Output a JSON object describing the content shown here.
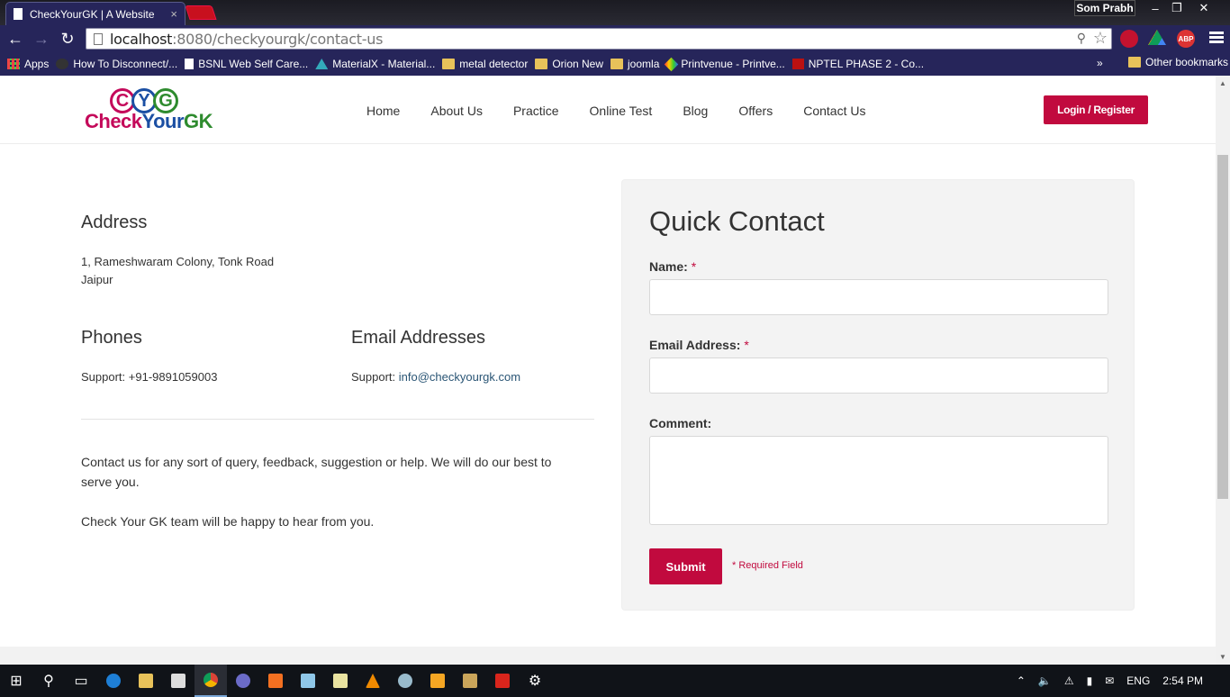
{
  "browser": {
    "tab_title": "CheckYourGK | A Website",
    "tab_close": "×",
    "user": "Som Prabh",
    "window_controls": [
      "–",
      "❐",
      "✕"
    ],
    "url_host": "localhost",
    "url_rest": ":8080/checkyourgk/contact-us",
    "extensions": [
      "ABP"
    ],
    "bookmarks": [
      {
        "label": "Apps",
        "icon": "apps-icon"
      },
      {
        "label": "How To Disconnect/...",
        "icon": "site-icon"
      },
      {
        "label": "BSNL Web Self Care...",
        "icon": "page-icon"
      },
      {
        "label": "MaterialX - Material...",
        "icon": "materialx-icon"
      },
      {
        "label": "metal detector",
        "icon": "folder-icon"
      },
      {
        "label": "Orion New",
        "icon": "folder-icon"
      },
      {
        "label": "joomla",
        "icon": "folder-icon"
      },
      {
        "label": "Printvenue - Printve...",
        "icon": "printvenue-icon"
      },
      {
        "label": "NPTEL PHASE 2 - Co...",
        "icon": "nptel-icon"
      }
    ],
    "bookmarks_more": "»",
    "other_bookmarks": "Other bookmarks"
  },
  "site": {
    "logo_letters": [
      "C",
      "Y",
      "G"
    ],
    "logo_word_1": "Check",
    "logo_word_2": "Your",
    "logo_word_3": "GK",
    "nav": [
      "Home",
      "About Us",
      "Practice",
      "Online Test",
      "Blog",
      "Offers",
      "Contact Us"
    ],
    "login_label": "Login / Register",
    "colors": {
      "accent": "#c10a3e",
      "logo_magenta": "#c4095a",
      "logo_blue": "#1b4fa3",
      "logo_green": "#2e8b2e"
    }
  },
  "contact_info": {
    "address_title": "Address",
    "address_line1": "1, Rameshwaram Colony, Tonk Road",
    "address_line2": "Jaipur",
    "phones_title": "Phones",
    "phone_prefix": "Support: ",
    "phone": "+91-9891059003",
    "email_title": "Email Addresses",
    "email_prefix": "Support: ",
    "email": "info@checkyourgk.com",
    "para1": "Contact us for any sort of query, feedback, suggestion or help. We will do our best to serve you.",
    "para2": "Check Your GK team will be happy to hear from you."
  },
  "quick_contact": {
    "title": "Quick Contact",
    "name_label": "Name:",
    "email_label": "Email Address:",
    "comment_label": "Comment:",
    "required_mark": "*",
    "name_value": "",
    "email_value": "",
    "comment_value": "",
    "submit_label": "Submit",
    "required_note": "* Required Field"
  },
  "taskbar": {
    "language": "ENG",
    "time": "2:54 PM"
  }
}
